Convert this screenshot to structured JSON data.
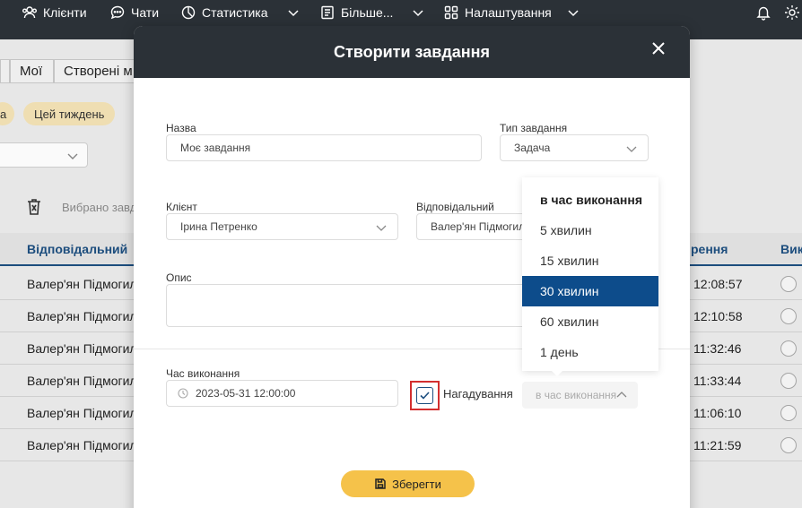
{
  "nav": {
    "items": [
      {
        "label": "Клієнти",
        "icon": "users-icon"
      },
      {
        "label": "Чати",
        "icon": "chat-icon"
      },
      {
        "label": "Статистика",
        "icon": "stats-icon"
      },
      {
        "label": "Більше...",
        "icon": "more-icon"
      },
      {
        "label": "Налаштування",
        "icon": "apps-icon"
      }
    ],
    "right_icons": [
      "bell-icon",
      "gear-icon"
    ]
  },
  "background": {
    "tabs": [
      "Мої",
      "Створені м"
    ],
    "filter_pills": [
      "a",
      "Цей тиждень"
    ],
    "selected_text": "Вибрано завд",
    "table": {
      "headers": [
        "Відповідальний",
        "рення",
        "Вик"
      ],
      "rows": [
        {
          "assignee": "Валер'ян Підмогиль",
          "time": "12:08:57"
        },
        {
          "assignee": "Валер'ян Підмогиль",
          "time": "12:10:58"
        },
        {
          "assignee": "Валер'ян Підмогиль",
          "time": "11:32:46"
        },
        {
          "assignee": "Валер'ян Підмогиль",
          "time": "11:33:44"
        },
        {
          "assignee": "Валер'ян Підмогиль",
          "time": "11:06:10"
        },
        {
          "assignee": "Валер'ян Підмогиль",
          "time": "11:21:59"
        }
      ]
    }
  },
  "modal": {
    "title": "Створити завдання",
    "name_label": "Назва",
    "name_value": "Моє завдання",
    "type_label": "Тип завдання",
    "type_value": "Задача",
    "client_label": "Клієнт",
    "client_value": "Ірина Петренко",
    "responsible_label": "Відповідальний",
    "responsible_value": "Валер'ян  Підмогиль",
    "description_label": "Опис",
    "description_value": "",
    "time_label": "Час виконання",
    "time_value": "2023-05-31 12:00:00",
    "reminder_label": "Нагадування",
    "reminder_checked": true,
    "reminder_placeholder": "в час виконання",
    "save_label": "Зберегти"
  },
  "reminder_dropdown": {
    "options": [
      "в час виконання",
      "5 хвилин",
      "15 хвилин",
      "30 хвилин",
      "60 хвилин",
      "1 день"
    ],
    "selected": "30 хвилин",
    "accent_color": "#0d4c8b"
  },
  "colors": {
    "header_bg": "#2b3137",
    "save_button": "#f5c24a",
    "table_header_text": "#1d4f80",
    "highlight_border": "#d32f2f"
  }
}
